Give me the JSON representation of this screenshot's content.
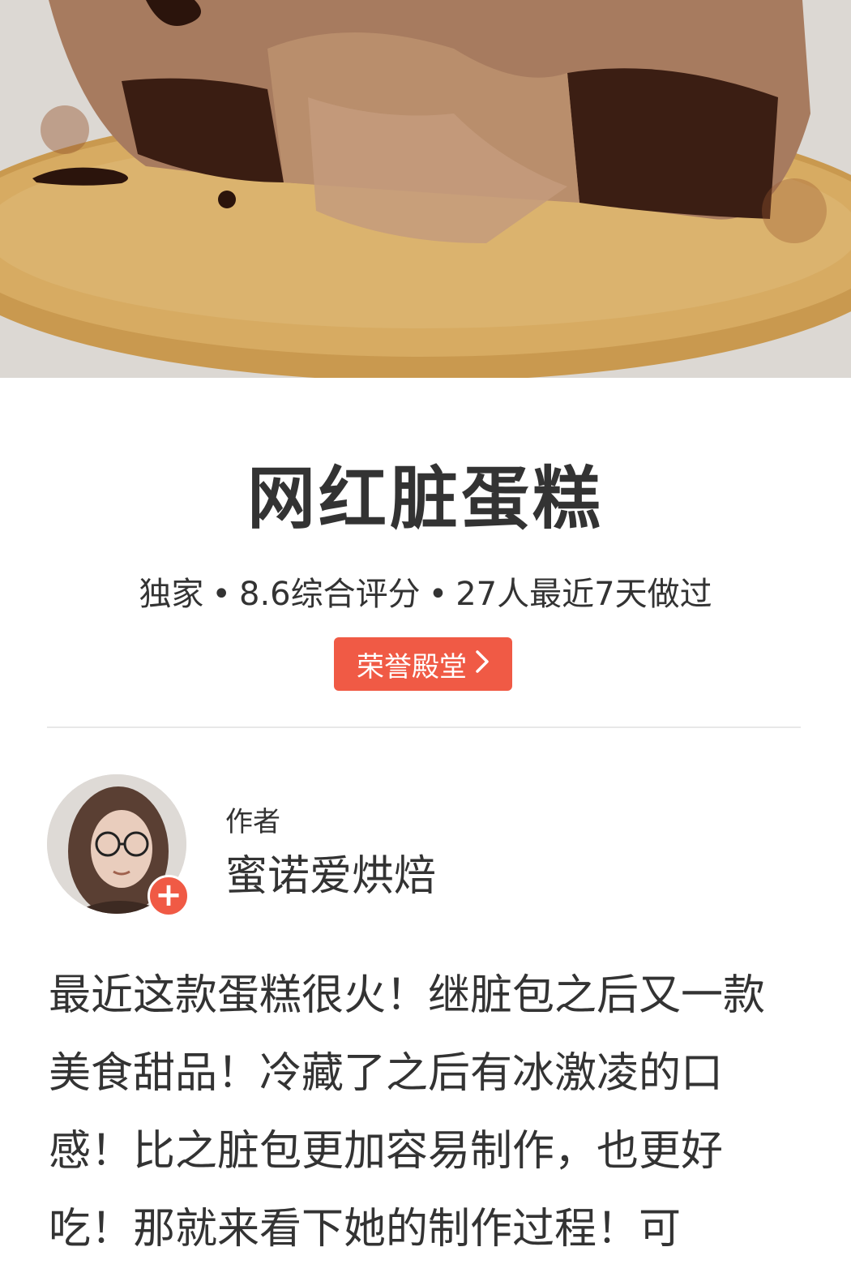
{
  "hero": {
    "image_subject": "cake-photo"
  },
  "recipe": {
    "title": "网红脏蛋糕",
    "meta": {
      "exclusive": "独家",
      "rating": "8.6综合评分",
      "recent_makers": "27人最近7天做过",
      "separator": "•"
    },
    "badge_label": "荣誉殿堂",
    "badge_icon": "chevron-right-icon"
  },
  "author": {
    "label": "作者",
    "name": "蜜诺爱烘焙",
    "follow_symbol": "+"
  },
  "description": "最近这款蛋糕很火！继脏包之后又一款美食甜品！冷藏了之后有冰激凌的口感！比之脏包更加容易制作，也更好吃！那就来看下她的制作过程！可",
  "colors": {
    "accent": "#f05a45",
    "text": "#333333",
    "divider": "#e8e8e8"
  }
}
